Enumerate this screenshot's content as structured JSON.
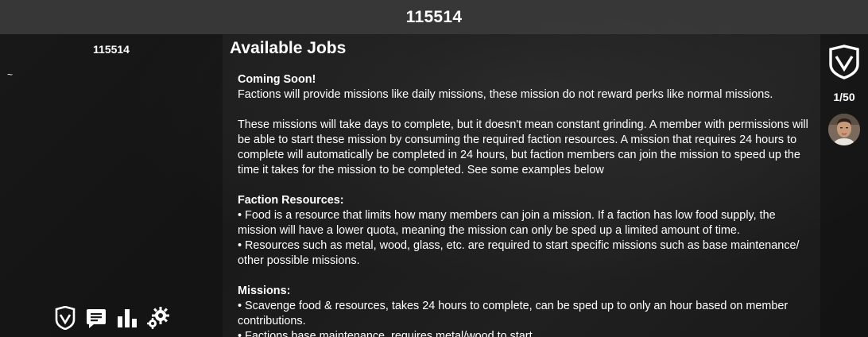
{
  "window": {
    "title": "115514"
  },
  "sidebar": {
    "faction_name": "115514",
    "tilde": "~",
    "nav": [
      {
        "icon": "faction-shield-icon",
        "label": ""
      },
      {
        "icon": "chat-icon",
        "label": ""
      },
      {
        "icon": "stats-icon",
        "label": ""
      },
      {
        "icon": "settings-icon",
        "label": ""
      }
    ]
  },
  "main": {
    "heading": "Available Jobs",
    "coming_soon": "Coming Soon!",
    "intro": " Factions will provide missions like daily missions, these mission do not reward perks like normal missions.",
    "paragraph2": " These missions will take days to complete, but it doesn't mean constant grinding. A member with permissions will be able to start these mission by consuming the required faction resources. A mission that requires 24 hours to complete will automatically be completed in 24 hours, but faction members can join the mission to speed up the time it takes for the mission to be completed. See some examples below",
    "resources_heading": " Faction Resources:",
    "resource_1": " • Food is a resource that limits how many members can join a mission. If a faction has low food supply, the mission will have a lower quota, meaning the mission can only be sped up a limited amount of time.",
    "resource_2": " • Resources such as metal, wood, glass, etc. are required to start specific missions such as base maintenance/ other possible missions.",
    "missions_heading": " Missions:",
    "mission_1": " • Scavenge food & resources, takes 24 hours to complete, can be sped up to only an hour based on member contributions.",
    "mission_2": " • Factions base maintenance, requires metal/wood to start"
  },
  "members": {
    "count": "1/50"
  },
  "colors": {
    "topbar": "#3a3a3a",
    "background": "#1c1c1c",
    "text": "#ffffff"
  }
}
